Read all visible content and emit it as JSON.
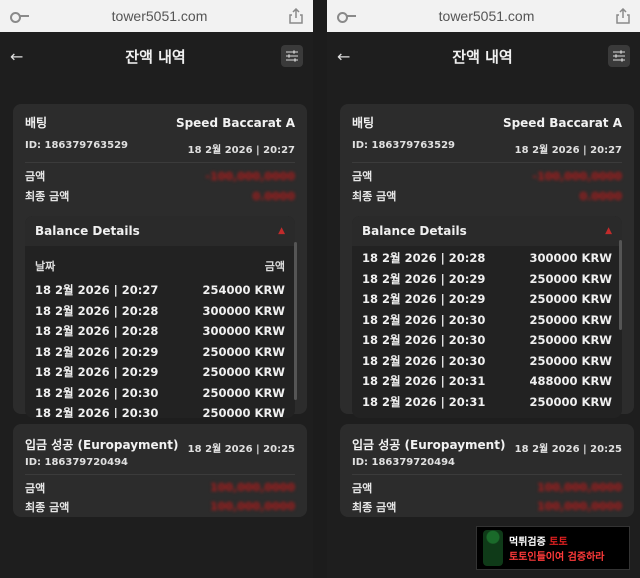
{
  "browser": {
    "url": "tower5051.com"
  },
  "header": {
    "title": "잔액 내역",
    "back_label": "←"
  },
  "bet_card": {
    "type": "배팅",
    "game": "Speed Baccarat A",
    "id": "ID: 186379763529",
    "time": "18 2월 2026 | 20:27",
    "amount_label": "금액",
    "amount_value": "-100,000,0000",
    "final_label": "최종 금액",
    "final_value": "0.0000"
  },
  "balance_details": {
    "title": "Balance Details",
    "date_header": "날짜",
    "amount_header": "금액",
    "left_rows": [
      {
        "date": "18 2월 2026 | 20:27",
        "amount": "254000 KRW"
      },
      {
        "date": "18 2월 2026 | 20:28",
        "amount": "300000 KRW"
      },
      {
        "date": "18 2월 2026 | 20:28",
        "amount": "300000 KRW"
      },
      {
        "date": "18 2월 2026 | 20:29",
        "amount": "250000 KRW"
      },
      {
        "date": "18 2월 2026 | 20:29",
        "amount": "250000 KRW"
      },
      {
        "date": "18 2월 2026 | 20:30",
        "amount": "250000 KRW"
      },
      {
        "date": "18 2월 2026 | 20:30",
        "amount": "250000 KRW"
      }
    ],
    "right_rows": [
      {
        "date": "18 2월 2026 | 20:28",
        "amount": "300000 KRW"
      },
      {
        "date": "18 2월 2026 | 20:29",
        "amount": "250000 KRW"
      },
      {
        "date": "18 2월 2026 | 20:29",
        "amount": "250000 KRW"
      },
      {
        "date": "18 2월 2026 | 20:30",
        "amount": "250000 KRW"
      },
      {
        "date": "18 2월 2026 | 20:30",
        "amount": "250000 KRW"
      },
      {
        "date": "18 2월 2026 | 20:30",
        "amount": "250000 KRW"
      },
      {
        "date": "18 2월 2026 | 20:31",
        "amount": "488000 KRW"
      },
      {
        "date": "18 2월 2026 | 20:31",
        "amount": "250000 KRW"
      }
    ]
  },
  "deposit_card": {
    "type": "입금 성공 (Europayment)",
    "id": "ID: 186379720494",
    "time": "18 2월 2026 | 20:25",
    "amount_label": "금액",
    "amount_value": "100,000,0000",
    "final_label": "최종 금액",
    "final_value": "100,000,0000"
  },
  "watermark": {
    "line1_a": "먹튀검증 ",
    "line1_b": "토토",
    "line2": "토토인들이여 검증하라"
  },
  "colors": {
    "accent_red": "#b01c1c",
    "card_bg": "#2c2c2c",
    "page_bg": "#1e1e1e"
  }
}
